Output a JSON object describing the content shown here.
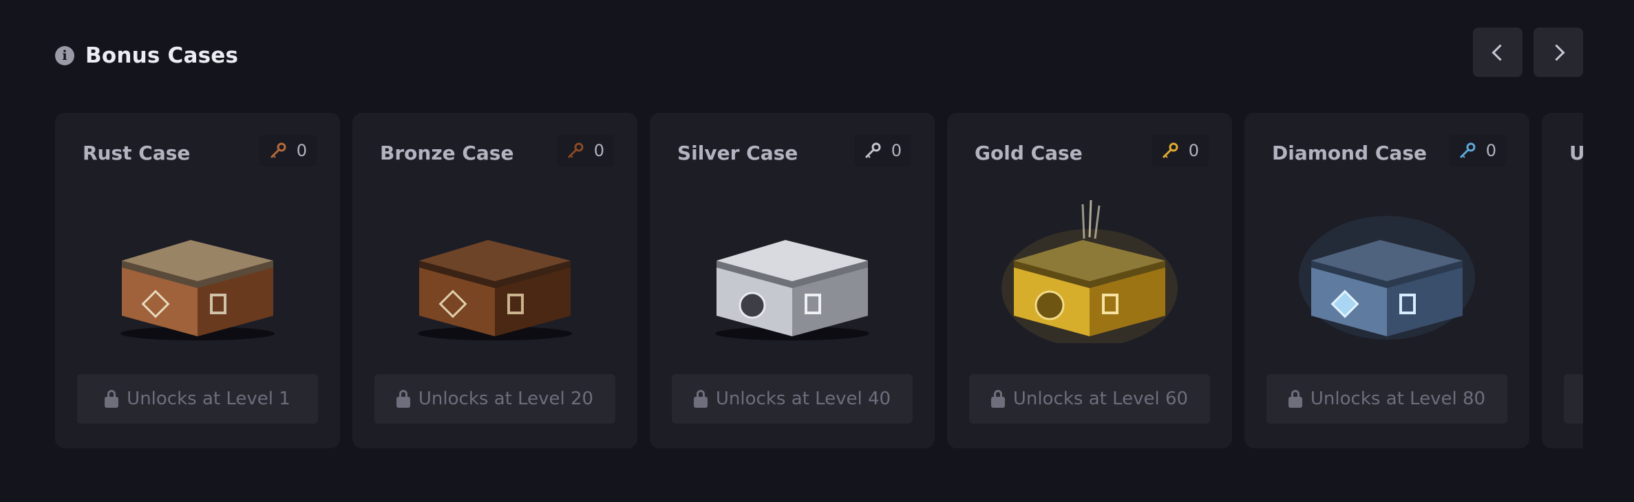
{
  "header": {
    "title": "Bonus Cases",
    "info_icon": "info-icon"
  },
  "nav": {
    "prev_icon": "chevron-left-icon",
    "next_icon": "chevron-right-icon"
  },
  "cases": [
    {
      "name": "Rust Case",
      "keys": "0",
      "unlock": "Unlocks at Level 1",
      "color": "#a0623a"
    },
    {
      "name": "Bronze Case",
      "keys": "0",
      "unlock": "Unlocks at Level 20",
      "color": "#7a4523"
    },
    {
      "name": "Silver Case",
      "keys": "0",
      "unlock": "Unlocks at Level 40",
      "color": "#b9bcc2"
    },
    {
      "name": "Gold Case",
      "keys": "0",
      "unlock": "Unlocks at Level 60",
      "color": "#d7ad2c"
    },
    {
      "name": "Diamond Case",
      "keys": "0",
      "unlock": "Unlocks at Level 80",
      "color": "#5f7ca0"
    },
    {
      "name": "U",
      "keys": "",
      "unlock": "",
      "color": "#3a3a44"
    }
  ]
}
